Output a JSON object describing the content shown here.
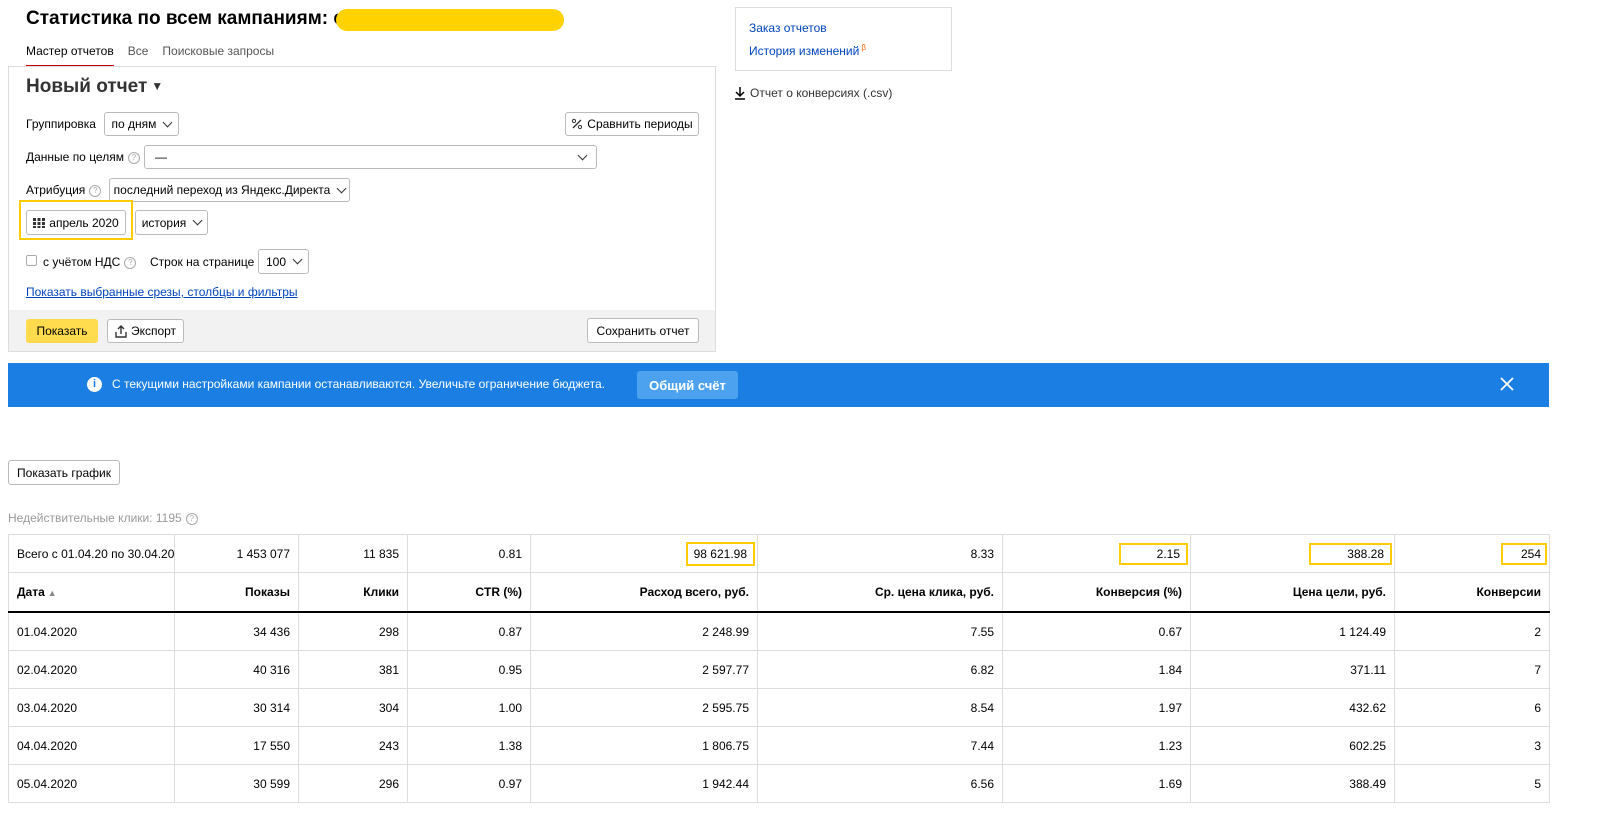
{
  "header": {
    "title": "Статистика по всем кампаниям: с"
  },
  "tabs": [
    "Мастер отчетов",
    "Все",
    "Поисковые запросы"
  ],
  "report": {
    "title": "Новый отчет",
    "grouping_label": "Группировка",
    "grouping_value": "по дням",
    "compare_label": "Сравнить периоды",
    "goals_label": "Данные по целям",
    "goals_value": "—",
    "attribution_label": "Атрибуция",
    "attribution_value": "последний переход из Яндекс.Директа",
    "period_value": "апрель 2020",
    "history_label": "история",
    "vat_label": "с учётом НДС",
    "rows_label": "Строк на странице",
    "rows_value": "100",
    "show_slices_link": "Показать выбранные срезы, столбцы и фильтры",
    "show_button": "Показать",
    "export_button": "Экспорт",
    "save_button": "Сохранить отчет"
  },
  "side": {
    "order_reports": "Заказ отчетов",
    "change_history": "История изменений",
    "beta": "β",
    "conversions_csv": "Отчет о конверсиях (.csv)"
  },
  "banner": {
    "text": "С текущими настройками кампании останавливаются. Увеличьте ограничение бюджета.",
    "button": "Общий счёт",
    "color": "#1a7ee3"
  },
  "show_chart_button": "Показать график",
  "invalid_clicks": "Недействительные клики: 1195",
  "table": {
    "columns": [
      "Дата",
      "Показы",
      "Клики",
      "CTR (%)",
      "Расход всего, руб.",
      "Ср. цена клика, руб.",
      "Конверсия (%)",
      "Цена цели, руб.",
      "Конверсии"
    ],
    "total": [
      "Всего с 01.04.20 по 30.04.20",
      "1 453 077",
      "11 835",
      "0.81",
      "98 621.98",
      "8.33",
      "2.15",
      "388.28",
      "254"
    ],
    "rows": [
      [
        "01.04.2020",
        "34 436",
        "298",
        "0.87",
        "2 248.99",
        "7.55",
        "0.67",
        "1 124.49",
        "2"
      ],
      [
        "02.04.2020",
        "40 316",
        "381",
        "0.95",
        "2 597.77",
        "6.82",
        "1.84",
        "371.11",
        "7"
      ],
      [
        "03.04.2020",
        "30 314",
        "304",
        "1.00",
        "2 595.75",
        "8.54",
        "1.97",
        "432.62",
        "6"
      ],
      [
        "04.04.2020",
        "17 550",
        "243",
        "1.38",
        "1 806.75",
        "7.44",
        "1.23",
        "602.25",
        "3"
      ],
      [
        "05.04.2020",
        "30 599",
        "296",
        "0.97",
        "1 942.44",
        "6.56",
        "1.69",
        "388.49",
        "5"
      ]
    ]
  },
  "colors": {
    "accent": "#ffdb4d",
    "highlight": "#ffcc00",
    "link": "#0044bb"
  }
}
